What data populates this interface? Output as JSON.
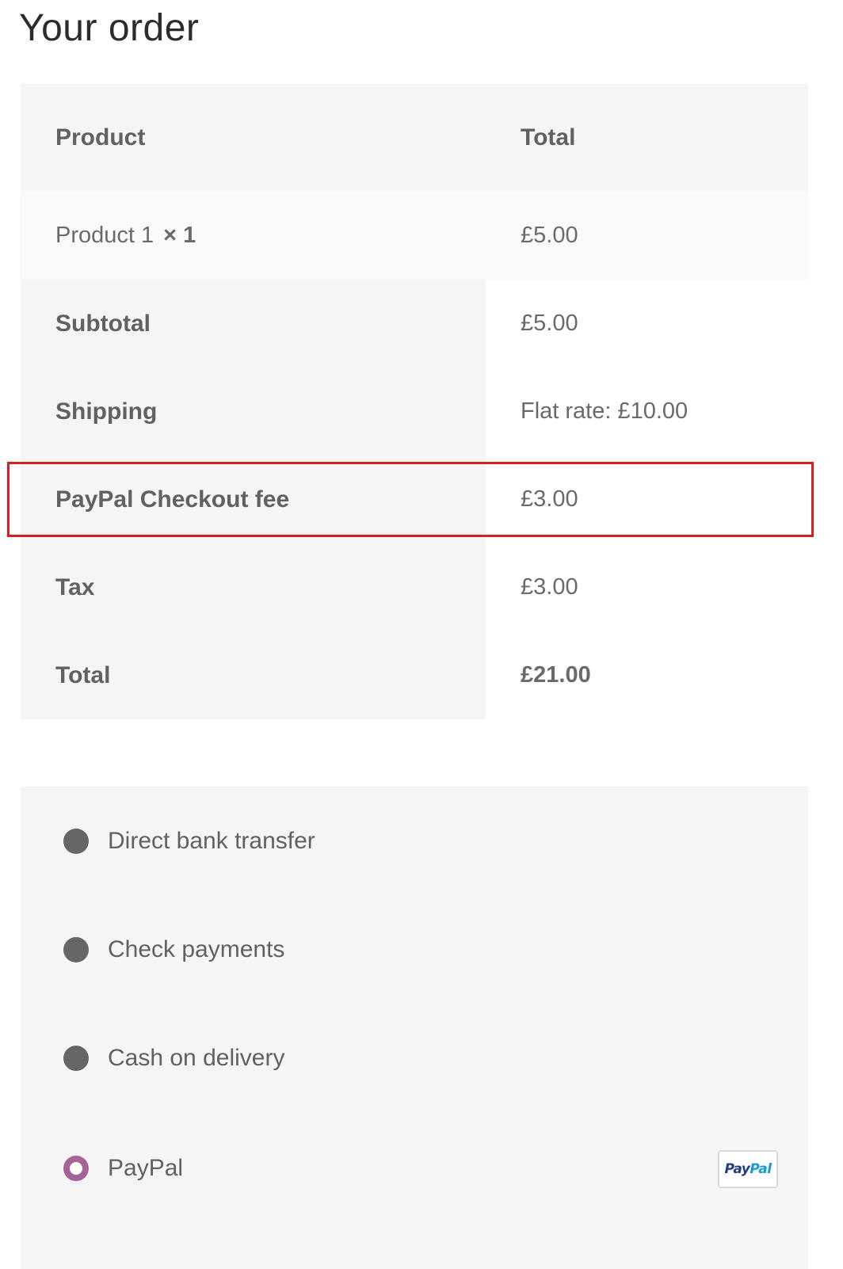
{
  "page": {
    "title": "Your order"
  },
  "order_table": {
    "header": {
      "product": "Product",
      "total": "Total"
    },
    "items": [
      {
        "name": "Product 1",
        "quantity": "× 1",
        "total": "£5.00"
      }
    ],
    "subtotal": {
      "label": "Subtotal",
      "value": "£5.00"
    },
    "shipping": {
      "label": "Shipping",
      "value": "Flat rate: £10.00"
    },
    "fee": {
      "label": "PayPal Checkout fee",
      "value": "£3.00",
      "highlighted": true
    },
    "tax": {
      "label": "Tax",
      "value": "£3.00"
    },
    "total": {
      "label": "Total",
      "value": "£21.00"
    }
  },
  "payment_methods": [
    {
      "label": "Direct bank transfer",
      "selected": false
    },
    {
      "label": "Check payments",
      "selected": false
    },
    {
      "label": "Cash on delivery",
      "selected": false
    },
    {
      "label": "PayPal",
      "selected": true,
      "logo_text_a": "Pay",
      "logo_text_b": "Pal"
    }
  ],
  "colors": {
    "highlight_border": "#d61f1f",
    "radio_selected": "#a46497",
    "radio_unselected": "#666666",
    "table_shade": "#f5f5f5"
  },
  "icons": {
    "paypal_logo": "paypal-logo-icon",
    "radio": "radio-button-icon"
  }
}
